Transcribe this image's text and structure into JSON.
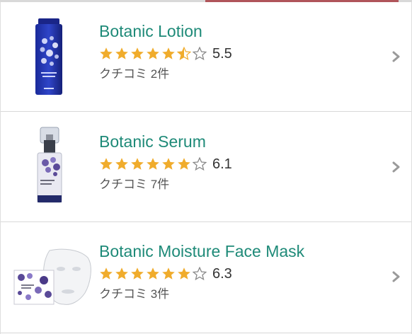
{
  "colors": {
    "title": "#1e8a78",
    "star_filled": "#f0ac2c",
    "star_empty": "#888888",
    "accent": "#b0555a",
    "chevron": "#9a9a9a"
  },
  "products": [
    {
      "name": "Botanic Lotion",
      "score": "5.5",
      "reviews": "クチコミ 2件",
      "stars": [
        "full",
        "full",
        "full",
        "full",
        "full",
        "half",
        "empty"
      ],
      "image_icon": "lotion-bottle-icon"
    },
    {
      "name": "Botanic Serum",
      "score": "6.1",
      "reviews": "クチコミ 7件",
      "stars": [
        "full",
        "full",
        "full",
        "full",
        "full",
        "full",
        "empty"
      ],
      "image_icon": "serum-bottle-icon"
    },
    {
      "name": "Botanic Moisture Face Mask",
      "score": "6.3",
      "reviews": "クチコミ 3件",
      "stars": [
        "full",
        "full",
        "full",
        "full",
        "full",
        "full",
        "empty"
      ],
      "image_icon": "face-mask-icon"
    }
  ]
}
